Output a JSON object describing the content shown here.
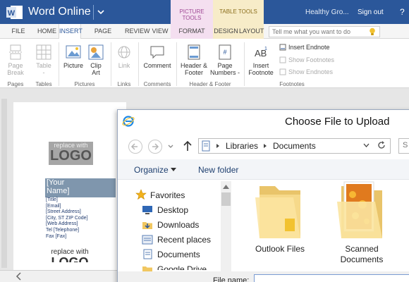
{
  "app": {
    "name": "Word Online",
    "user": "Healthy Gro...",
    "sign_out": "Sign out",
    "help": "?",
    "context_picture": "PICTURE TOOLS",
    "context_table": "TABLE TOOLS",
    "brand_color": "#2b579a"
  },
  "tabs": [
    "FILE",
    "HOME",
    "INSERT",
    "PAGE LAYOUT",
    "REVIEW",
    "VIEW",
    "FORMAT",
    "DESIGN",
    "LAYOUT"
  ],
  "tell_me": {
    "placeholder": "Tell me what you want to do"
  },
  "ribbon": {
    "page_break": [
      "Page",
      "Break"
    ],
    "table": [
      "Table",
      "-"
    ],
    "picture": "Picture",
    "clip_art": [
      "Clip",
      "Art"
    ],
    "link": "Link",
    "comment": "Comment",
    "header_footer": [
      "Header &",
      "Footer"
    ],
    "page_numbers": [
      "Page",
      "Numbers -"
    ],
    "insert_footnote": [
      "Insert",
      "Footnote"
    ],
    "insert_endnote": "Insert Endnote",
    "show_footnotes": "Show Footnotes",
    "show_endnotes": "Show Endnotes",
    "groups": [
      "Pages",
      "Tables",
      "Pictures",
      "Links",
      "Comments",
      "Header & Footer",
      "Footnotes"
    ]
  },
  "document": {
    "logo_small": "replace with",
    "logo_big": "LOGO",
    "name_line1": "[Your",
    "name_line2": "Name]",
    "address_lines": [
      "[Title]",
      "[Email]",
      "[Street Address]",
      "[City, ST  ZIP Code]",
      "[Web Address]",
      "Tel  [Telephone]",
      "Fax  [Fax]"
    ],
    "logo2_small": "replace with",
    "logo2_big": "LOGO"
  },
  "dialog": {
    "title": "Choose File to Upload",
    "path": [
      "Libraries",
      "Documents"
    ],
    "organize": "Organize",
    "new_folder": "New folder",
    "nav_items": [
      "Favorites",
      "Desktop",
      "Downloads",
      "Recent places",
      "Documents",
      "Google Drive"
    ],
    "files": [
      {
        "name": "Outlook Files"
      },
      {
        "name": "Scanned Documents"
      }
    ],
    "file_name_label": "File name:",
    "file_name_value": ""
  }
}
